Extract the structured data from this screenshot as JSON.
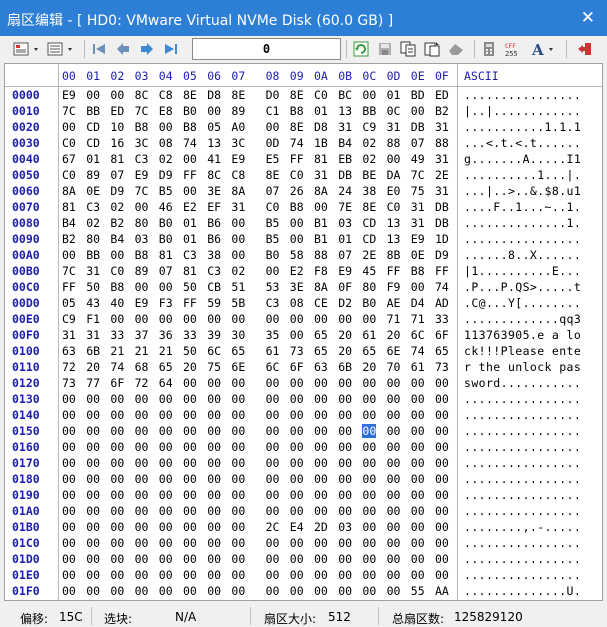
{
  "window": {
    "title": "扇区编辑 - [ HD0: VMware Virtual NVMe Disk (60.0 GB) ]",
    "close_label": "✕"
  },
  "toolbar": {
    "offset_value": "0"
  },
  "hex": {
    "columns": [
      "00",
      "01",
      "02",
      "03",
      "04",
      "05",
      "06",
      "07",
      "08",
      "09",
      "0A",
      "0B",
      "0C",
      "0D",
      "0E",
      "0F"
    ],
    "ascii_header": "ASCII",
    "selected_offset": "0x15C",
    "rows": [
      {
        "offset": "0000",
        "bytes": [
          "E9",
          "00",
          "00",
          "8C",
          "C8",
          "8E",
          "D8",
          "8E",
          "D0",
          "8E",
          "C0",
          "BC",
          "00",
          "01",
          "BD",
          "ED"
        ],
        "ascii": "................"
      },
      {
        "offset": "0010",
        "bytes": [
          "7C",
          "BB",
          "ED",
          "7C",
          "E8",
          "B0",
          "00",
          "89",
          "C1",
          "B8",
          "01",
          "13",
          "BB",
          "0C",
          "00",
          "B2"
        ],
        "ascii": "|..|............"
      },
      {
        "offset": "0020",
        "bytes": [
          "00",
          "CD",
          "10",
          "B8",
          "00",
          "B8",
          "05",
          "A0",
          "00",
          "8E",
          "D8",
          "31",
          "C9",
          "31",
          "DB",
          "31"
        ],
        "ascii": "...........1.1.1"
      },
      {
        "offset": "0030",
        "bytes": [
          "C0",
          "CD",
          "16",
          "3C",
          "08",
          "74",
          "13",
          "3C",
          "0D",
          "74",
          "1B",
          "B4",
          "02",
          "88",
          "07",
          "88"
        ],
        "ascii": "...<.t.<.t......"
      },
      {
        "offset": "0040",
        "bytes": [
          "67",
          "01",
          "81",
          "C3",
          "02",
          "00",
          "41",
          "E9",
          "E5",
          "FF",
          "81",
          "EB",
          "02",
          "00",
          "49",
          "31"
        ],
        "ascii": "g.......A.....I1"
      },
      {
        "offset": "0050",
        "bytes": [
          "C0",
          "89",
          "07",
          "E9",
          "D9",
          "FF",
          "8C",
          "C8",
          "8E",
          "C0",
          "31",
          "DB",
          "BE",
          "DA",
          "7C",
          "2E"
        ],
        "ascii": "..........1...|."
      },
      {
        "offset": "0060",
        "bytes": [
          "8A",
          "0E",
          "D9",
          "7C",
          "B5",
          "00",
          "3E",
          "8A",
          "07",
          "26",
          "8A",
          "24",
          "38",
          "E0",
          "75",
          "31"
        ],
        "ascii": "...|..>..&.$8.u1"
      },
      {
        "offset": "0070",
        "bytes": [
          "81",
          "C3",
          "02",
          "00",
          "46",
          "E2",
          "EF",
          "31",
          "C0",
          "B8",
          "00",
          "7E",
          "8E",
          "C0",
          "31",
          "DB"
        ],
        "ascii": "....F..1...~..1."
      },
      {
        "offset": "0080",
        "bytes": [
          "B4",
          "02",
          "B2",
          "80",
          "B0",
          "01",
          "B6",
          "00",
          "B5",
          "00",
          "B1",
          "03",
          "CD",
          "13",
          "31",
          "DB"
        ],
        "ascii": "..............1."
      },
      {
        "offset": "0090",
        "bytes": [
          "B2",
          "80",
          "B4",
          "03",
          "B0",
          "01",
          "B6",
          "00",
          "B5",
          "00",
          "B1",
          "01",
          "CD",
          "13",
          "E9",
          "1D"
        ],
        "ascii": "................"
      },
      {
        "offset": "00A0",
        "bytes": [
          "00",
          "BB",
          "00",
          "B8",
          "81",
          "C3",
          "38",
          "00",
          "B0",
          "58",
          "88",
          "07",
          "2E",
          "8B",
          "0E",
          "D9"
        ],
        "ascii": "......8..X......"
      },
      {
        "offset": "00B0",
        "bytes": [
          "7C",
          "31",
          "C0",
          "89",
          "07",
          "81",
          "C3",
          "02",
          "00",
          "E2",
          "F8",
          "E9",
          "45",
          "FF",
          "B8",
          "FF"
        ],
        "ascii": "|1..........E..."
      },
      {
        "offset": "00C0",
        "bytes": [
          "FF",
          "50",
          "B8",
          "00",
          "00",
          "50",
          "CB",
          "51",
          "53",
          "3E",
          "8A",
          "0F",
          "80",
          "F9",
          "00",
          "74"
        ],
        "ascii": ".P...P.QS>.....t"
      },
      {
        "offset": "00D0",
        "bytes": [
          "05",
          "43",
          "40",
          "E9",
          "F3",
          "FF",
          "59",
          "5B",
          "C3",
          "08",
          "CE",
          "D2",
          "B0",
          "AE",
          "D4",
          "AD"
        ],
        "ascii": ".C@...Y[........"
      },
      {
        "offset": "00E0",
        "bytes": [
          "C9",
          "F1",
          "00",
          "00",
          "00",
          "00",
          "00",
          "00",
          "00",
          "00",
          "00",
          "00",
          "00",
          "71",
          "71",
          "33"
        ],
        "ascii": ".............qq3"
      },
      {
        "offset": "00F0",
        "bytes": [
          "31",
          "31",
          "33",
          "37",
          "36",
          "33",
          "39",
          "30",
          "35",
          "00",
          "65",
          "20",
          "61",
          "20",
          "6C",
          "6F"
        ],
        "ascii": "113763905.e a lo"
      },
      {
        "offset": "0100",
        "bytes": [
          "63",
          "6B",
          "21",
          "21",
          "21",
          "50",
          "6C",
          "65",
          "61",
          "73",
          "65",
          "20",
          "65",
          "6E",
          "74",
          "65"
        ],
        "ascii": "ck!!!Please ente"
      },
      {
        "offset": "0110",
        "bytes": [
          "72",
          "20",
          "74",
          "68",
          "65",
          "20",
          "75",
          "6E",
          "6C",
          "6F",
          "63",
          "6B",
          "20",
          "70",
          "61",
          "73"
        ],
        "ascii": "r the unlock pas"
      },
      {
        "offset": "0120",
        "bytes": [
          "73",
          "77",
          "6F",
          "72",
          "64",
          "00",
          "00",
          "00",
          "00",
          "00",
          "00",
          "00",
          "00",
          "00",
          "00",
          "00"
        ],
        "ascii": "sword..........."
      },
      {
        "offset": "0130",
        "bytes": [
          "00",
          "00",
          "00",
          "00",
          "00",
          "00",
          "00",
          "00",
          "00",
          "00",
          "00",
          "00",
          "00",
          "00",
          "00",
          "00"
        ],
        "ascii": "................"
      },
      {
        "offset": "0140",
        "bytes": [
          "00",
          "00",
          "00",
          "00",
          "00",
          "00",
          "00",
          "00",
          "00",
          "00",
          "00",
          "00",
          "00",
          "00",
          "00",
          "00"
        ],
        "ascii": "................"
      },
      {
        "offset": "0150",
        "bytes": [
          "00",
          "00",
          "00",
          "00",
          "00",
          "00",
          "00",
          "00",
          "00",
          "00",
          "00",
          "00",
          "00",
          "00",
          "00",
          "00"
        ],
        "ascii": "................"
      },
      {
        "offset": "0160",
        "bytes": [
          "00",
          "00",
          "00",
          "00",
          "00",
          "00",
          "00",
          "00",
          "00",
          "00",
          "00",
          "00",
          "00",
          "00",
          "00",
          "00"
        ],
        "ascii": "................"
      },
      {
        "offset": "0170",
        "bytes": [
          "00",
          "00",
          "00",
          "00",
          "00",
          "00",
          "00",
          "00",
          "00",
          "00",
          "00",
          "00",
          "00",
          "00",
          "00",
          "00"
        ],
        "ascii": "................"
      },
      {
        "offset": "0180",
        "bytes": [
          "00",
          "00",
          "00",
          "00",
          "00",
          "00",
          "00",
          "00",
          "00",
          "00",
          "00",
          "00",
          "00",
          "00",
          "00",
          "00"
        ],
        "ascii": "................"
      },
      {
        "offset": "0190",
        "bytes": [
          "00",
          "00",
          "00",
          "00",
          "00",
          "00",
          "00",
          "00",
          "00",
          "00",
          "00",
          "00",
          "00",
          "00",
          "00",
          "00"
        ],
        "ascii": "................"
      },
      {
        "offset": "01A0",
        "bytes": [
          "00",
          "00",
          "00",
          "00",
          "00",
          "00",
          "00",
          "00",
          "00",
          "00",
          "00",
          "00",
          "00",
          "00",
          "00",
          "00"
        ],
        "ascii": "................"
      },
      {
        "offset": "01B0",
        "bytes": [
          "00",
          "00",
          "00",
          "00",
          "00",
          "00",
          "00",
          "00",
          "2C",
          "E4",
          "2D",
          "03",
          "00",
          "00",
          "00",
          "00"
        ],
        "ascii": "........,.-....."
      },
      {
        "offset": "01C0",
        "bytes": [
          "00",
          "00",
          "00",
          "00",
          "00",
          "00",
          "00",
          "00",
          "00",
          "00",
          "00",
          "00",
          "00",
          "00",
          "00",
          "00"
        ],
        "ascii": "................"
      },
      {
        "offset": "01D0",
        "bytes": [
          "00",
          "00",
          "00",
          "00",
          "00",
          "00",
          "00",
          "00",
          "00",
          "00",
          "00",
          "00",
          "00",
          "00",
          "00",
          "00"
        ],
        "ascii": "................"
      },
      {
        "offset": "01E0",
        "bytes": [
          "00",
          "00",
          "00",
          "00",
          "00",
          "00",
          "00",
          "00",
          "00",
          "00",
          "00",
          "00",
          "00",
          "00",
          "00",
          "00"
        ],
        "ascii": "................"
      },
      {
        "offset": "01F0",
        "bytes": [
          "00",
          "00",
          "00",
          "00",
          "00",
          "00",
          "00",
          "00",
          "00",
          "00",
          "00",
          "00",
          "00",
          "00",
          "55",
          "AA"
        ],
        "ascii": "..............U."
      }
    ]
  },
  "status": {
    "offset_label": "偏移:",
    "offset_value": "15C",
    "selection_label": "选块:",
    "selection_value": "N/A",
    "sector_size_label": "扇区大小:",
    "sector_size_value": "512",
    "total_sectors_label": "总扇区数:",
    "total_sectors_value": "125829120"
  },
  "colors": {
    "titlebar": "#2d7fd6",
    "offset_text": "#1c1cb0",
    "selection": "#2f6fd6"
  },
  "toolbar_icons": [
    "grid-view-icon",
    "list-view-icon",
    "first-sector-icon",
    "previous-sector-icon",
    "next-sector-icon",
    "last-sector-icon",
    "refresh-icon",
    "save-icon",
    "copy-sector-icon",
    "paste-sector-icon",
    "erase-icon",
    "calculator-icon",
    "checksum-icon",
    "font-icon",
    "exit-icon"
  ]
}
